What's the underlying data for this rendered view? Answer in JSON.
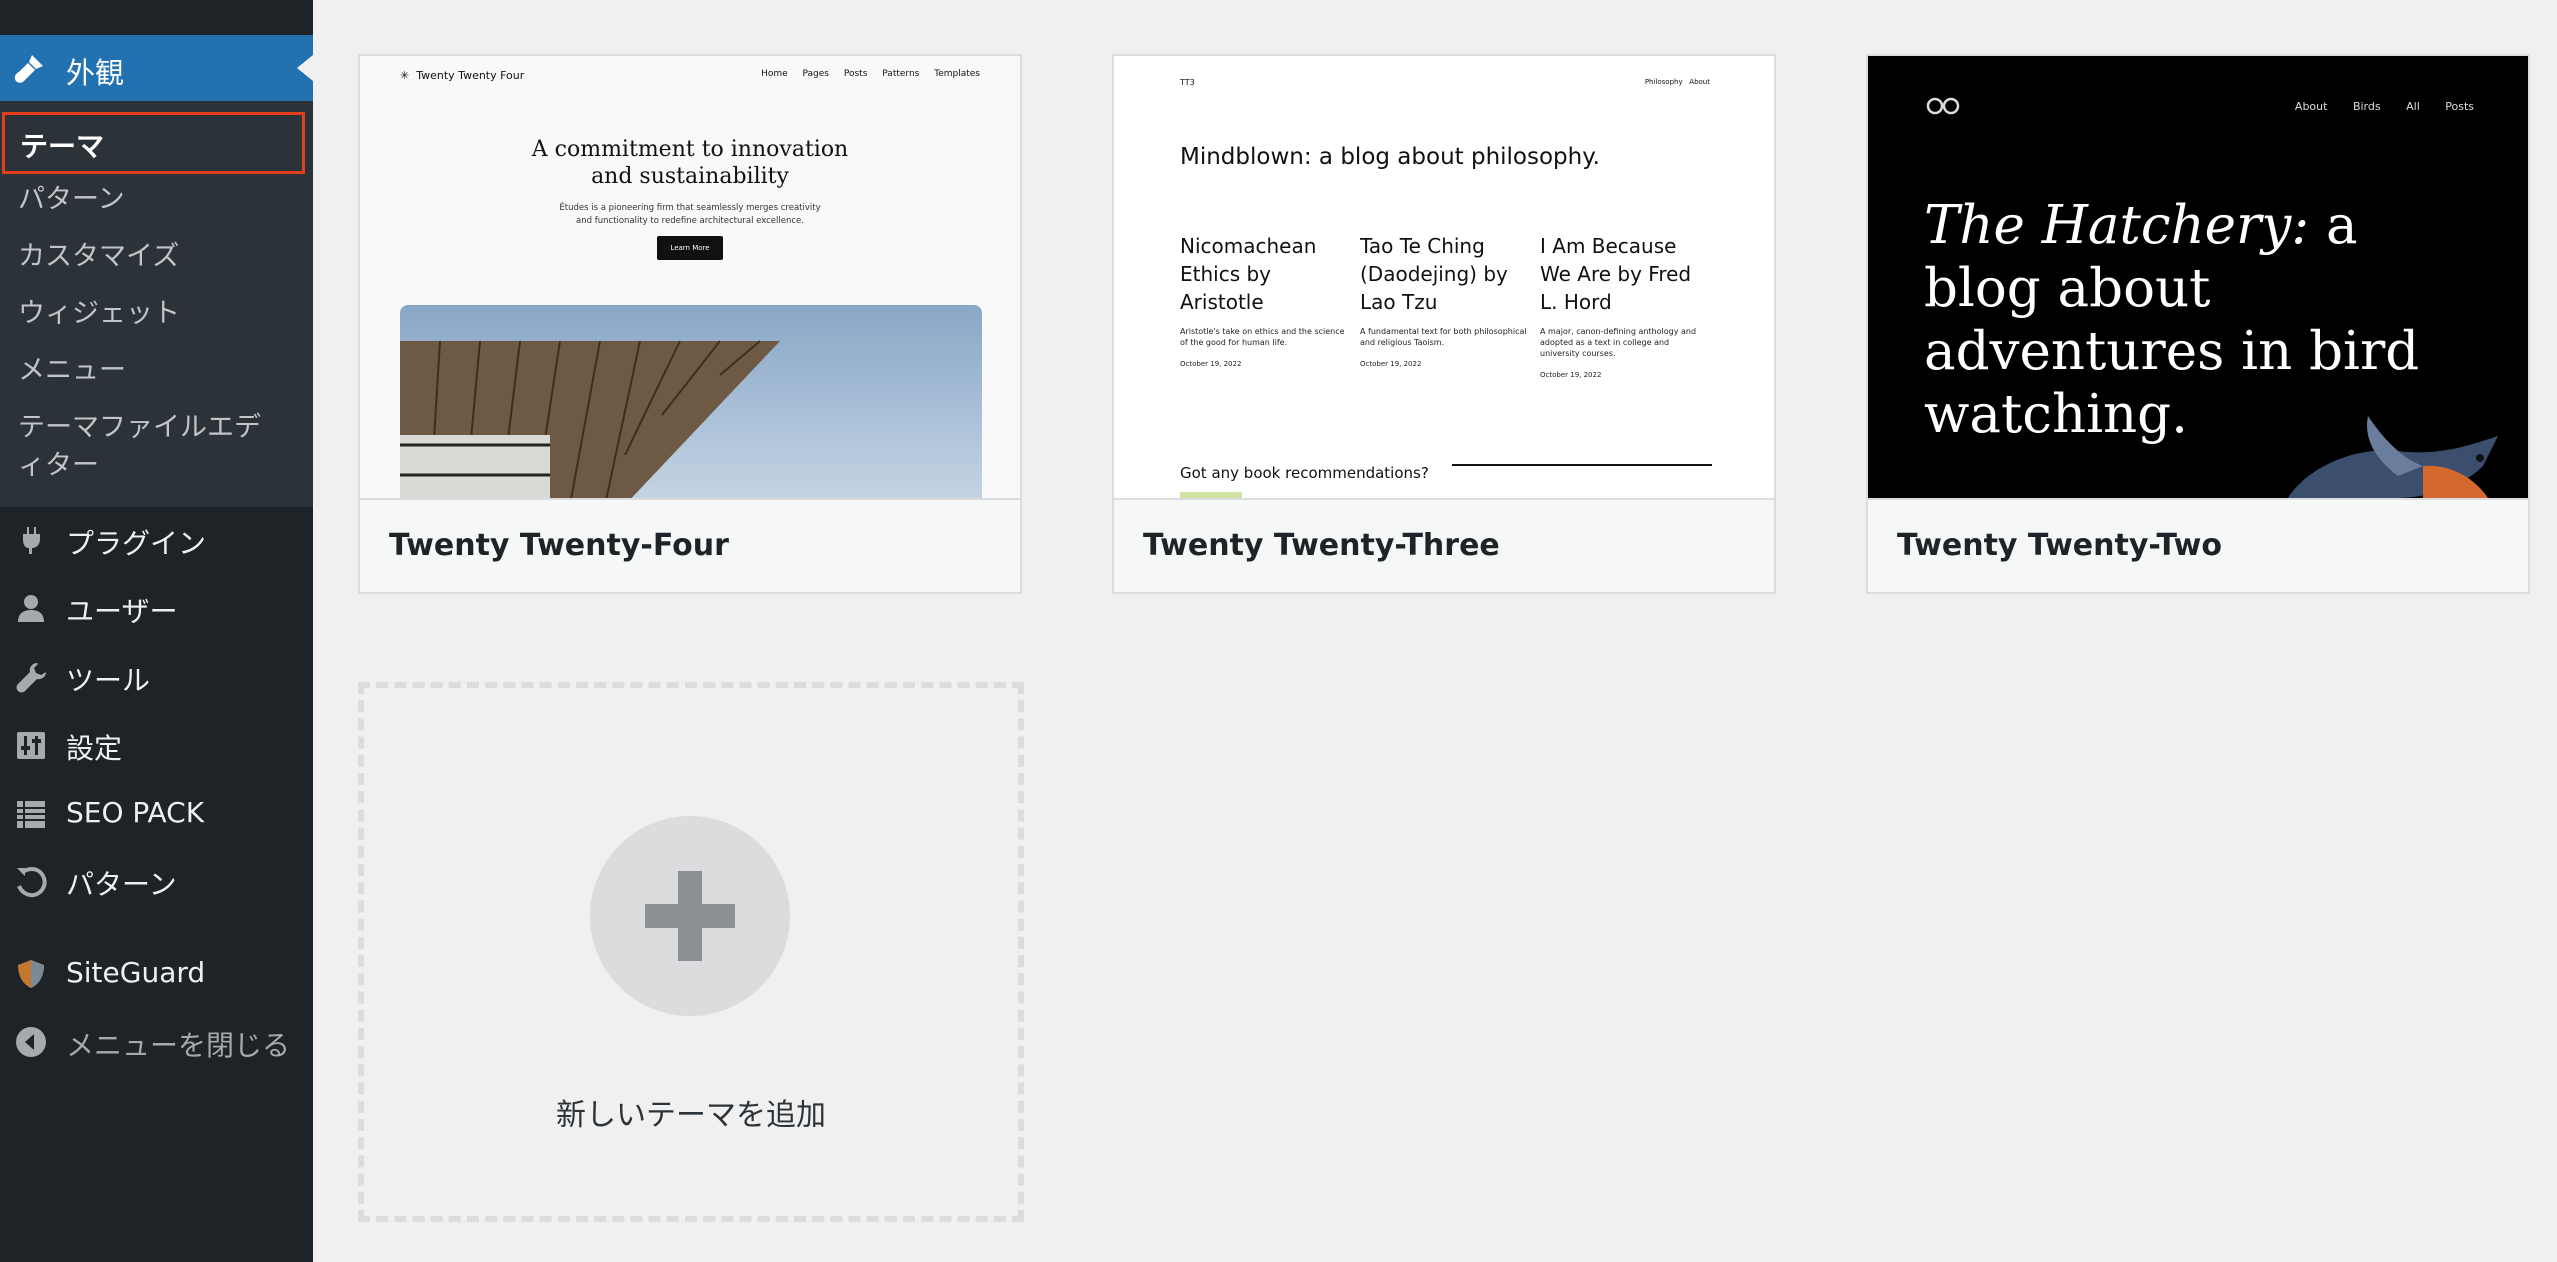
{
  "sidebar": {
    "appearance": {
      "label": "外観"
    },
    "submenu": [
      {
        "label": "テーマ",
        "current": true
      },
      {
        "label": "パターン"
      },
      {
        "label": "カスタマイズ"
      },
      {
        "label": "ウィジェット"
      },
      {
        "label": "メニュー"
      },
      {
        "label": "テーマファイルエディター"
      }
    ],
    "items": [
      {
        "label": "プラグイン",
        "icon": "plugin-icon"
      },
      {
        "label": "ユーザー",
        "icon": "user-icon"
      },
      {
        "label": "ツール",
        "icon": "wrench-icon"
      },
      {
        "label": "設定",
        "icon": "settings-icon"
      },
      {
        "label": "SEO PACK",
        "icon": "list-icon"
      },
      {
        "label": "パターン",
        "icon": "undo-icon"
      },
      {
        "label": "SiteGuard",
        "icon": "shield-icon"
      },
      {
        "label": "メニューを閉じる",
        "icon": "collapse-icon"
      }
    ]
  },
  "themes": [
    {
      "name": "Twenty Twenty-Four",
      "preview": {
        "site_title": "Twenty Twenty Four",
        "nav": [
          "Home",
          "Pages",
          "Posts",
          "Patterns",
          "Templates"
        ],
        "headline_1": "A commitment to innovation",
        "headline_2": "and sustainability",
        "paragraph_1": "Études is a pioneering firm that seamlessly merges creativity",
        "paragraph_2": "and functionality to redefine architectural excellence.",
        "button": "Learn More"
      }
    },
    {
      "name": "Twenty Twenty-Three",
      "preview": {
        "logo": "TT3",
        "nav": [
          "Philosophy",
          "About"
        ],
        "headline": "Mindblown: a blog about philosophy.",
        "posts": [
          {
            "title": "Nicomachean Ethics by Aristotle",
            "excerpt": "Aristotle's take on ethics and the science of the good for human life.",
            "date": "October 19, 2022"
          },
          {
            "title": "Tao Te Ching (Daodejing) by Lao Tzu",
            "excerpt": "A fundamental text for both philosophical and religious Taoism.",
            "date": "October 19, 2022"
          },
          {
            "title": "I Am Because We Are by Fred L. Hord",
            "excerpt": "A major, canon-defining anthology and adopted as a text in college and university courses.",
            "date": "October 19, 2022"
          }
        ],
        "cta": "Got any book recommendations?"
      }
    },
    {
      "name": "Twenty Twenty-Two",
      "preview": {
        "nav": [
          "About",
          "Birds",
          "All Posts"
        ],
        "headline_italic": "The Hatchery:",
        "headline_rest": " a blog about adventures in bird watching."
      }
    }
  ],
  "add_theme": {
    "label": "新しいテーマを追加"
  },
  "colors": {
    "sidebar_bg": "#1d2327",
    "active_bg": "#2271b1",
    "highlight_border": "#e2401c",
    "content_bg": "#f0f0f1"
  }
}
